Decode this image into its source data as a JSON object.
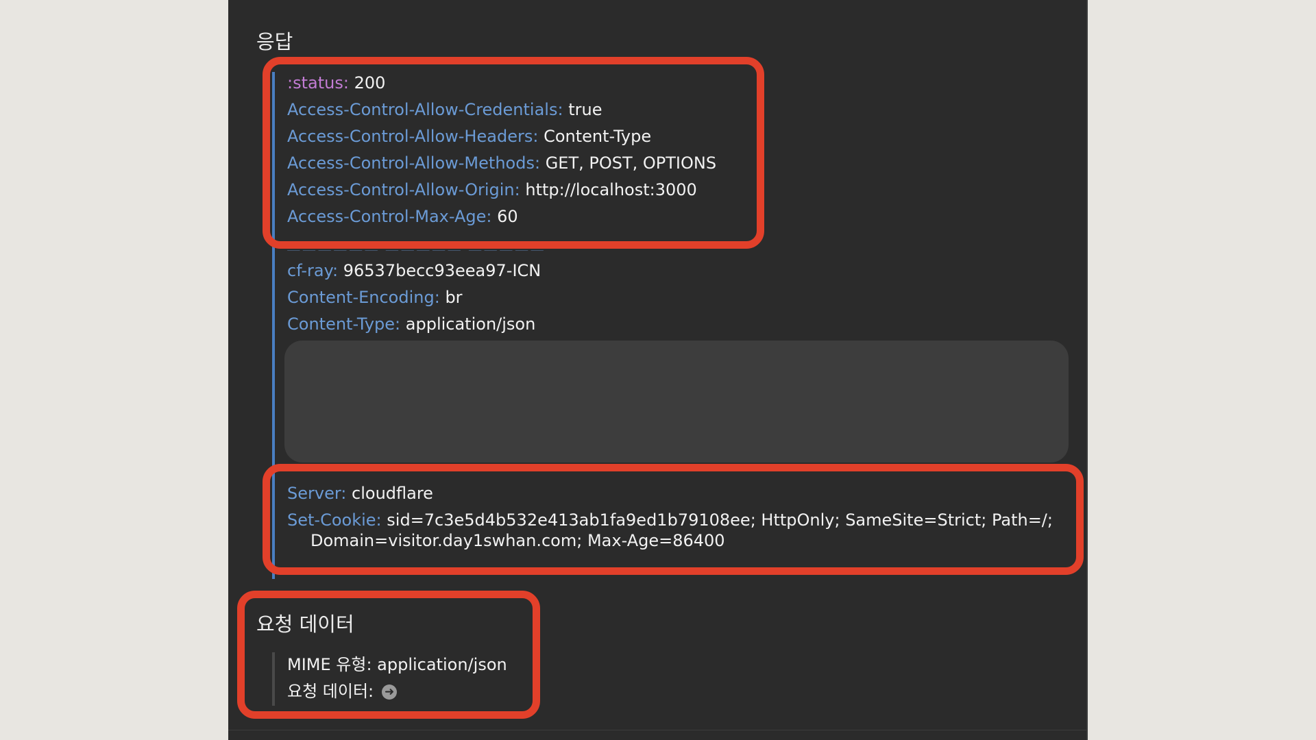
{
  "response": {
    "title": "응답",
    "headers_top": [
      {
        "key": ":status:",
        "value": "200"
      },
      {
        "key": "Access-Control-Allow-Credentials:",
        "value": "true"
      },
      {
        "key": "Access-Control-Allow-Headers:",
        "value": "Content-Type"
      },
      {
        "key": "Access-Control-Allow-Methods:",
        "value": "GET, POST, OPTIONS"
      },
      {
        "key": "Access-Control-Allow-Origin:",
        "value": "http://localhost:3000"
      },
      {
        "key": "Access-Control-Max-Age:",
        "value": "60"
      }
    ],
    "headers_mid": [
      {
        "key": "cf-ray:",
        "value": "96537becc93eea97-ICN"
      },
      {
        "key": "Content-Encoding:",
        "value": "br"
      },
      {
        "key": "Content-Type:",
        "value": "application/json"
      }
    ],
    "server": {
      "key": "Server:",
      "value": "cloudflare"
    },
    "set_cookie": {
      "key": "Set-Cookie:",
      "value_line1": "sid=7c3e5d4b532e413ab1fa9ed1b79108ee; HttpOnly; SameSite=Strict; Path=/;",
      "value_line2": "Domain=visitor.day1swhan.com; Max-Age=86400"
    }
  },
  "request_data": {
    "title": "요청 데이터",
    "mime_label": "MIME 유형:",
    "mime_value": "application/json",
    "data_label": "요청 데이터:",
    "arrow_icon": "arrow-right-circle-icon"
  },
  "colors": {
    "panel_bg": "#2b2b2b",
    "header_key": "#6b9bd6",
    "status_key": "#c27cd4",
    "highlight": "#e2402a"
  }
}
